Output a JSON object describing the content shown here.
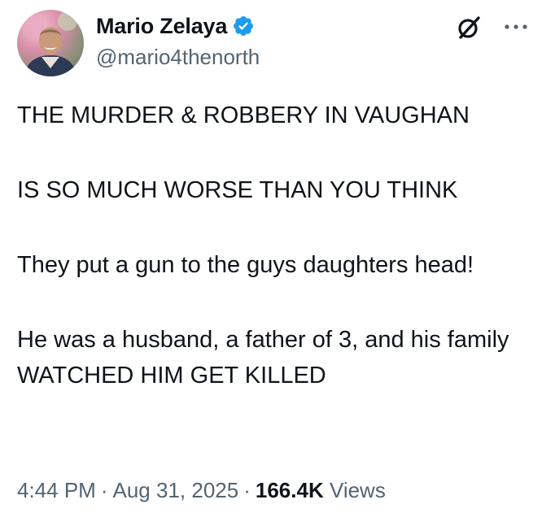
{
  "author": {
    "display_name": "Mario Zelaya",
    "handle": "@mario4thenorth",
    "verified": true,
    "verified_color": "#1d9bf0"
  },
  "icons": {
    "grok": "grok-icon",
    "more": "more-options-icon",
    "verified": "verified-badge-icon"
  },
  "tweet": {
    "paragraphs": [
      "THE MURDER & ROBBERY IN VAUGHAN",
      "IS SO MUCH WORSE THAN YOU THINK",
      "They put a gun to the guys daughters head!",
      "He was a husband, a father of 3, and his family WATCHED HIM GET KILLED"
    ]
  },
  "meta": {
    "time": "4:44 PM",
    "separator": "·",
    "date": "Aug 31, 2025",
    "views_count": "166.4K",
    "views_label": "Views"
  },
  "colors": {
    "text_primary": "#0f1419",
    "text_secondary": "#536471"
  }
}
